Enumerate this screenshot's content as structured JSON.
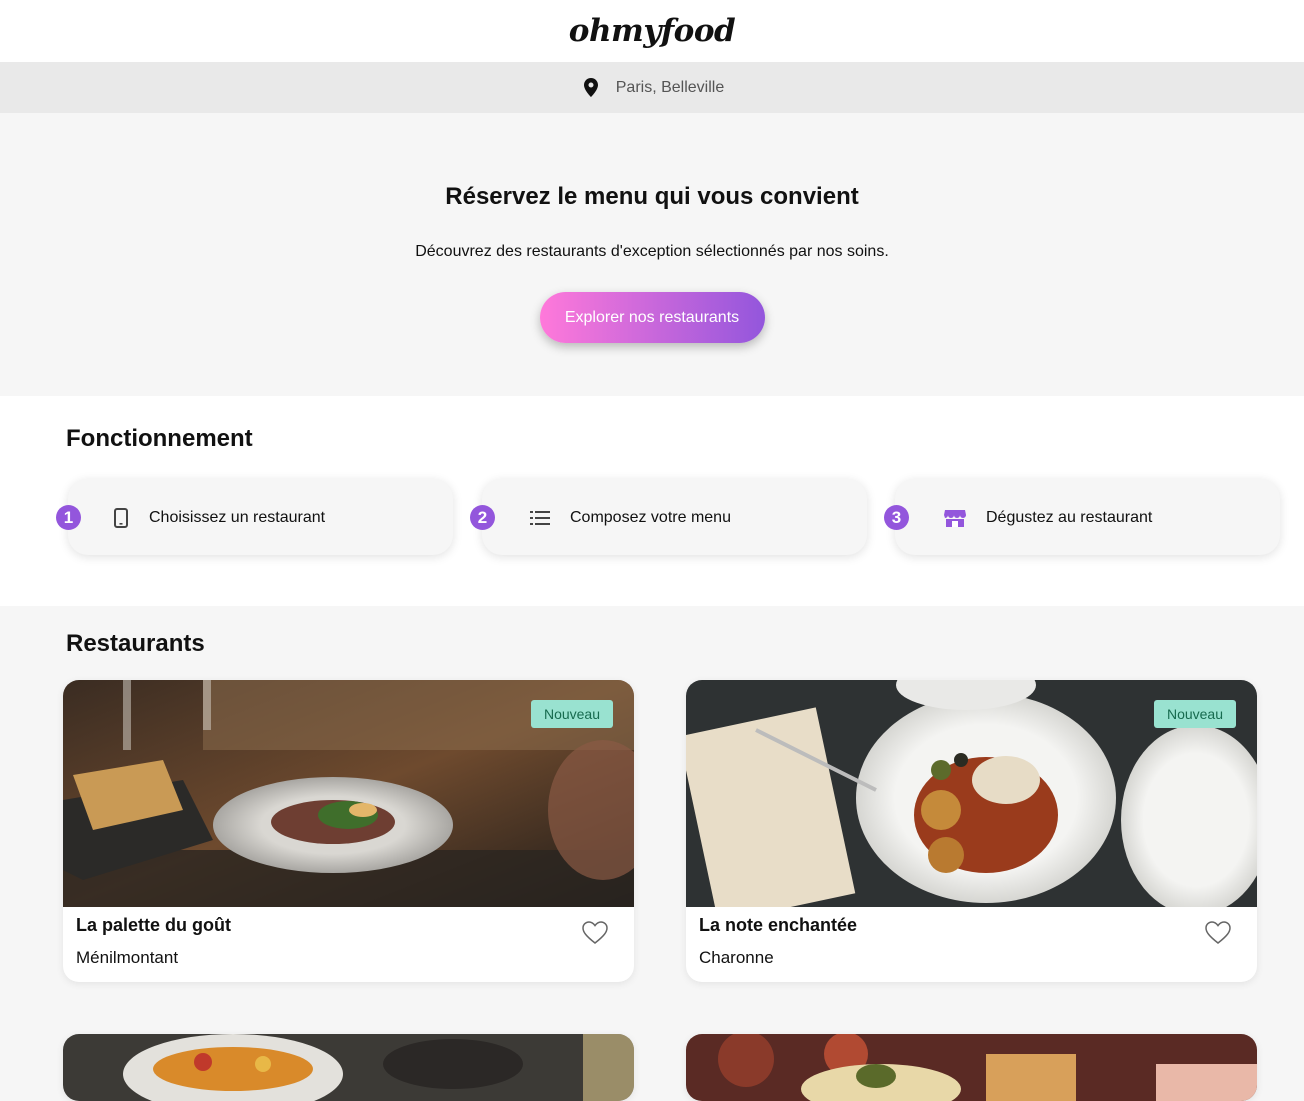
{
  "header": {
    "logo": "ohmyfood"
  },
  "location": {
    "text": "Paris, Belleville",
    "icon": "map-pin-icon"
  },
  "hero": {
    "title": "Réservez le menu qui vous convient",
    "subtitle": "Découvrez des restaurants d'exception sélectionnés par nos soins.",
    "cta_label": "Explorer nos restaurants"
  },
  "how_it_works": {
    "title": "Fonctionnement",
    "steps": [
      {
        "number": "1",
        "icon": "phone-icon",
        "label": "Choisissez un restaurant"
      },
      {
        "number": "2",
        "icon": "list-icon",
        "label": "Composez votre menu"
      },
      {
        "number": "3",
        "icon": "store-icon",
        "label": "Dégustez au restaurant"
      }
    ]
  },
  "restaurants": {
    "title": "Restaurants",
    "items": [
      {
        "name": "La palette du goût",
        "area": "Ménilmontant",
        "badge": "Nouveau"
      },
      {
        "name": "La note enchantée",
        "area": "Charonne",
        "badge": "Nouveau"
      }
    ]
  },
  "colors": {
    "accent_start": "#ff79da",
    "accent_end": "#9356dc",
    "badge_bg": "#99e2d0",
    "badge_text": "#176b4f"
  }
}
